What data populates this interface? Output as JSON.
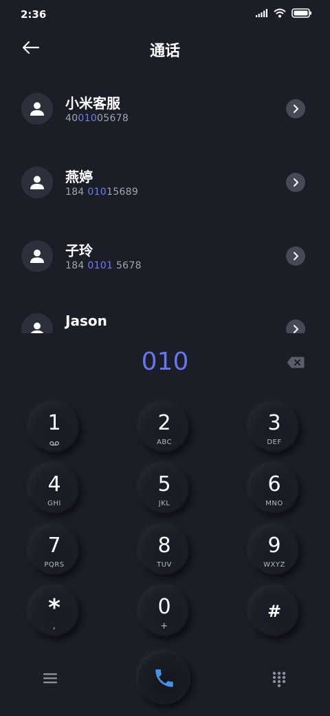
{
  "status": {
    "time": "2:36"
  },
  "header": {
    "title": "通话"
  },
  "contacts": [
    {
      "name": "小米客服",
      "number_pre": "40",
      "number_hl": "010",
      "number_post": "05678"
    },
    {
      "name": "燕婷",
      "number_pre": "184 ",
      "number_hl": "010",
      "number_post": "15689"
    },
    {
      "name": "子玲",
      "number_pre": "184 ",
      "number_hl": "0101",
      "number_post": " 5678"
    },
    {
      "name": "Jason",
      "number_pre": "",
      "number_hl": "",
      "number_post": ""
    }
  ],
  "dial": {
    "input": "010"
  },
  "keypad": [
    {
      "digit": "1",
      "letters": ""
    },
    {
      "digit": "2",
      "letters": "ABC"
    },
    {
      "digit": "3",
      "letters": "DEF"
    },
    {
      "digit": "4",
      "letters": "GHI"
    },
    {
      "digit": "5",
      "letters": "JKL"
    },
    {
      "digit": "6",
      "letters": "MNO"
    },
    {
      "digit": "7",
      "letters": "PQRS"
    },
    {
      "digit": "8",
      "letters": "TUV"
    },
    {
      "digit": "9",
      "letters": "WXYZ"
    },
    {
      "digit": "*",
      "letters": ","
    },
    {
      "digit": "0",
      "letters": "+"
    },
    {
      "digit": "#",
      "letters": ""
    }
  ],
  "icons": {
    "back": "arrow-left-icon",
    "voicemail": "voicemail-icon",
    "call": "phone-icon",
    "menu": "menu-icon",
    "dialpad": "dialpad-icon",
    "backspace": "backspace-icon",
    "chevron": "chevron-right-icon"
  },
  "colors": {
    "background": "#1b1d27",
    "accent": "#6576ee",
    "call_icon": "#4a90e2"
  }
}
